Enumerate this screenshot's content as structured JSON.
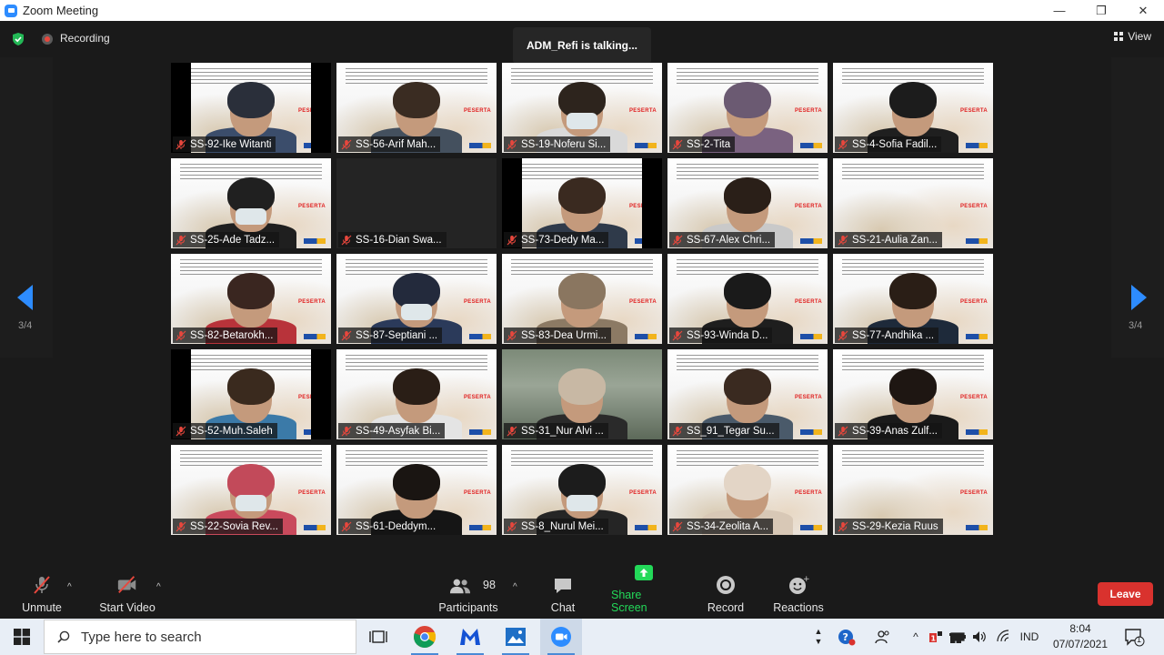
{
  "window": {
    "title": "Zoom Meeting",
    "minimize": "—",
    "restore": "❐",
    "close": "✕"
  },
  "meeting": {
    "recording_label": "Recording",
    "talking_text": "ADM_Refi is talking...",
    "view_label": "View",
    "page_left": "3/4",
    "page_right": "3/4"
  },
  "participants": [
    {
      "label": "SS-92-Ike Witanti",
      "bg": "banner",
      "side": "black",
      "head": "#2a2f3a",
      "body": "#3b4d6b",
      "mask": false
    },
    {
      "label": "SS-56-Arif Mah...",
      "bg": "banner",
      "side": "",
      "head": "#3a2c22",
      "body": "#44505e",
      "mask": false
    },
    {
      "label": "SS-19-Noferu Si...",
      "bg": "banner",
      "side": "",
      "head": "#2d241d",
      "body": "#d9d9d9",
      "mask": true
    },
    {
      "label": "SS-2-Tita",
      "bg": "banner",
      "side": "",
      "head": "#6b5a72",
      "body": "#7a6280",
      "mask": false
    },
    {
      "label": "SS-4-Sofia Fadil...",
      "bg": "banner",
      "side": "",
      "head": "#1c1c1c",
      "body": "#1f1f1f",
      "mask": false
    },
    {
      "label": "SS-25-Ade Tadz...",
      "bg": "banner",
      "side": "",
      "head": "#202020",
      "body": "#1f1f1f",
      "mask": true
    },
    {
      "label": "SS-16-Dian Swa...",
      "bg": "dark",
      "side": "",
      "head": "",
      "body": "",
      "mask": false
    },
    {
      "label": "SS-73-Dedy Ma...",
      "bg": "banner",
      "side": "black",
      "head": "#3a2a20",
      "body": "#2f3a4a",
      "mask": false
    },
    {
      "label": "SS-67-Alex Chri...",
      "bg": "banner",
      "side": "",
      "head": "#2a1f18",
      "body": "#c9c9c9",
      "mask": false
    },
    {
      "label": "SS-21-Aulia Zan...",
      "bg": "banner",
      "side": "",
      "head": "",
      "body": "",
      "mask": false
    },
    {
      "label": "SS-82-Betarokh...",
      "bg": "banner",
      "side": "",
      "head": "#3a2620",
      "body": "#b8333a",
      "mask": false
    },
    {
      "label": "SS-87-Septiani ...",
      "bg": "banner",
      "side": "",
      "head": "#232a3c",
      "body": "#2b3a5a",
      "mask": true
    },
    {
      "label": "SS-83-Dea Urmi...",
      "bg": "banner",
      "side": "",
      "head": "#8a7660",
      "body": "#8c7a64",
      "mask": false
    },
    {
      "label": "SS-93-Winda D...",
      "bg": "banner",
      "side": "",
      "head": "#1a1a1a",
      "body": "#1e1e1e",
      "mask": false
    },
    {
      "label": "SS-77-Andhika ...",
      "bg": "banner",
      "side": "",
      "head": "#2a1e16",
      "body": "#1e2a3a",
      "mask": false
    },
    {
      "label": "SS-52-Muh.Saleh",
      "bg": "banner",
      "side": "black",
      "head": "#3a2a1e",
      "body": "#3b7aa8",
      "mask": false
    },
    {
      "label": "SS-49-Asyfak Bi...",
      "bg": "banner",
      "side": "",
      "head": "#2a1e16",
      "body": "#e4e4e4",
      "mask": false
    },
    {
      "label": "SS-31_Nur Alvi ...",
      "bg": "room",
      "side": "",
      "head": "#c8b8a4",
      "body": "#2a2a2a",
      "mask": false
    },
    {
      "label": "SS_91_Tegar Su...",
      "bg": "banner",
      "side": "",
      "head": "#3a2a20",
      "body": "#4a5a6a",
      "mask": false
    },
    {
      "label": "SS-39-Anas Zulf...",
      "bg": "banner",
      "side": "",
      "head": "#1e1612",
      "body": "#1a1a1a",
      "mask": false
    },
    {
      "label": "SS-22-Sovia Rev...",
      "bg": "banner",
      "side": "",
      "head": "#c24a5a",
      "body": "#c94a5c",
      "mask": true
    },
    {
      "label": "SS-61-Deddym...",
      "bg": "banner",
      "side": "",
      "head": "#1a1512",
      "body": "#151515",
      "mask": false
    },
    {
      "label": "SS-8_Nurul Mei...",
      "bg": "banner",
      "side": "",
      "head": "#1c1c1c",
      "body": "#252525",
      "mask": true
    },
    {
      "label": "SS-34-Zeolita A...",
      "bg": "banner",
      "side": "",
      "head": "#e3d5c6",
      "body": "#d8c8b6",
      "mask": false
    },
    {
      "label": "SS-29-Kezia Ruus",
      "bg": "banner",
      "side": "",
      "head": "",
      "body": "",
      "mask": false
    }
  ],
  "banner": {
    "peserta": "PESERTA"
  },
  "toolbar": {
    "unmute": "Unmute",
    "start_video": "Start Video",
    "participants_label": "Participants",
    "participants_count": "98",
    "chat": "Chat",
    "share_screen": "Share Screen",
    "record": "Record",
    "reactions": "Reactions",
    "leave": "Leave",
    "caret": "^"
  },
  "taskbar": {
    "search_placeholder": "Type here to search",
    "language": "IND",
    "time": "8:04",
    "date": "07/07/2021",
    "notification_count": "1",
    "caret": "^"
  },
  "colors": {
    "accent": "#2d8cff",
    "share_green": "#23d959",
    "leave_red": "#d9322e",
    "muted_red": "#e8473d"
  }
}
